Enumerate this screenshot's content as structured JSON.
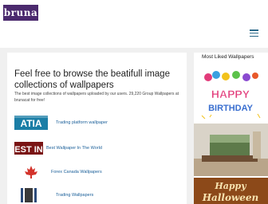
{
  "site": {
    "logo_text": "bruna"
  },
  "main": {
    "headline": "Feel free to browse the beatifull image collections of wallpapers",
    "intro": "The best image collections of wallpapers uploaded by our users. 29,220 Group Wallpapers at brunacat for free!",
    "items": [
      {
        "label": "Trading platform wallpaper",
        "thumb_text": "ATIA"
      },
      {
        "label": "Best Wallpaper In The World",
        "thumb_text": "EST IN"
      },
      {
        "label": "Forex Canada Wallpapers",
        "thumb_text": ""
      },
      {
        "label": "Trading Wallpapers",
        "thumb_text": ""
      }
    ]
  },
  "sidebar": {
    "title": "Most Liked Wallpapers",
    "birthday_word1": "HAPPY",
    "birthday_word2": "BIRTHDAY",
    "halloween_word1": "Happy",
    "halloween_word2": "Halloween"
  },
  "colors": {
    "link": "#1a5f99",
    "logo_bg": "#4b2a6e",
    "trading_thumb": "#1b7ea6",
    "forex_maple": "#d3332b",
    "page_bg": "#f0f0f0"
  }
}
